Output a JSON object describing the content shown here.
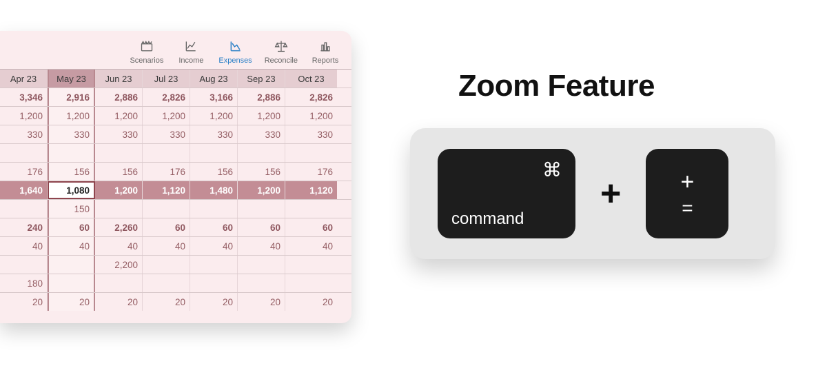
{
  "right": {
    "title": "Zoom Feature",
    "keys": {
      "cmd_symbol": "⌘",
      "cmd_label": "command",
      "separator": "+",
      "plus_top": "+",
      "plus_bottom": "="
    }
  },
  "toolbar": [
    {
      "name": "scenarios",
      "label": "Scenarios",
      "active": false
    },
    {
      "name": "income",
      "label": "Income",
      "active": false
    },
    {
      "name": "expenses",
      "label": "Expenses",
      "active": true
    },
    {
      "name": "reconcile",
      "label": "Reconcile",
      "active": false
    },
    {
      "name": "reports",
      "label": "Reports",
      "active": false
    }
  ],
  "columns": [
    "Apr 23",
    "May 23",
    "Jun 23",
    "Jul 23",
    "Aug 23",
    "Sep 23",
    "Oct 23"
  ],
  "selected_column": 1,
  "selected_row": 5,
  "rows": [
    {
      "type": "totals",
      "values": [
        "3,346",
        "2,916",
        "2,886",
        "2,826",
        "3,166",
        "2,886",
        "2,826"
      ]
    },
    {
      "type": "data",
      "values": [
        "1,200",
        "1,200",
        "1,200",
        "1,200",
        "1,200",
        "1,200",
        "1,200"
      ]
    },
    {
      "type": "data",
      "values": [
        "330",
        "330",
        "330",
        "330",
        "330",
        "330",
        "330"
      ]
    },
    {
      "type": "blank",
      "values": [
        "",
        "",
        "",
        "",
        "",
        "",
        ""
      ]
    },
    {
      "type": "data",
      "values": [
        "176",
        "156",
        "156",
        "176",
        "156",
        "156",
        "176"
      ]
    },
    {
      "type": "hl",
      "values": [
        "1,640",
        "1,080",
        "1,200",
        "1,120",
        "1,480",
        "1,200",
        "1,120"
      ]
    },
    {
      "type": "data",
      "values": [
        "",
        "150",
        "",
        "",
        "",
        "",
        ""
      ]
    },
    {
      "type": "sub",
      "values": [
        "240",
        "60",
        "2,260",
        "60",
        "60",
        "60",
        "60"
      ]
    },
    {
      "type": "data",
      "values": [
        "40",
        "40",
        "40",
        "40",
        "40",
        "40",
        "40"
      ]
    },
    {
      "type": "data",
      "values": [
        "",
        "",
        "2,200",
        "",
        "",
        "",
        ""
      ]
    },
    {
      "type": "data",
      "values": [
        "180",
        "",
        "",
        "",
        "",
        "",
        ""
      ]
    },
    {
      "type": "data",
      "values": [
        "20",
        "20",
        "20",
        "20",
        "20",
        "20",
        "20"
      ]
    }
  ]
}
